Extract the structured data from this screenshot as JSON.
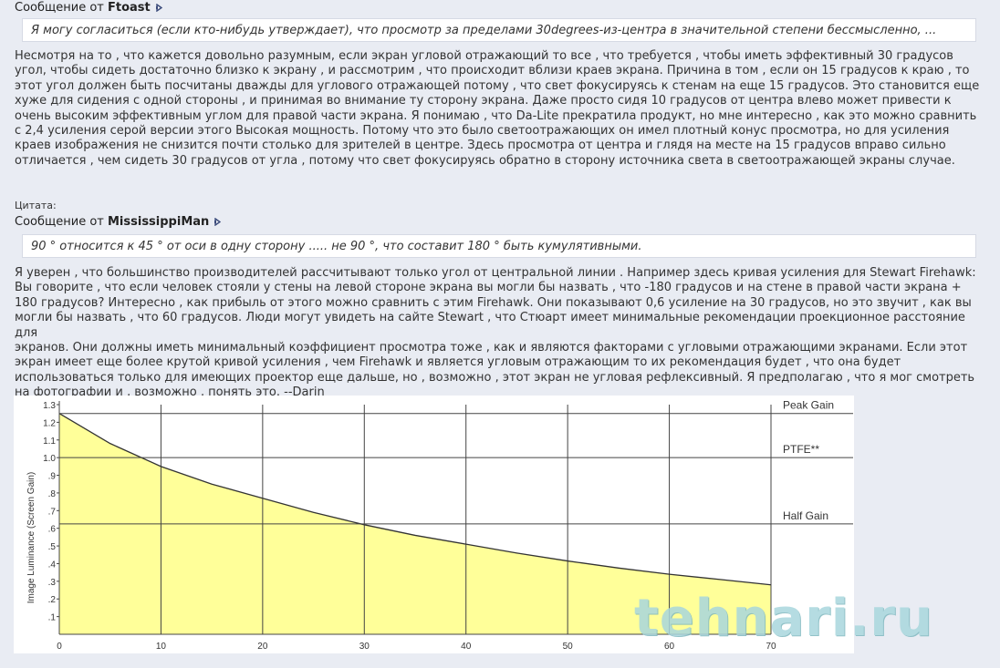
{
  "post1": {
    "quote_by_prefix": "Сообщение от",
    "quote_by_user": "Ftoast",
    "quote_text": "Я могу согласиться (если кто-нибудь утверждает), что просмотр за пределами 30degrees-из-центра в значительной степени бессмысленно, ...",
    "body": "Несмотря на то , что кажется довольно разумным, если экран угловой отражающий то все , что требуется , чтобы иметь эффективный 30 градусов\nугол, чтобы сидеть достаточно близко к экрану , и рассмотрим , что происходит вблизи краев экрана. Причина в том , если он 15 градусов к краю , то\nэтот угол должен быть посчитаны дважды для углового отражающей потому , что свет фокусируясь к стенам на еще 15 градусов. Это становится еще\nхуже для сидения с одной стороны , и принимая во внимание ту сторону экрана. Даже просто сидя 10 градусов от центра влево может привести к\nочень высоким эффективным углом для правой части экрана. Я понимаю , что Da-Lite прекратила продукт, но мне интересно , как это можно сравнить\nс 2,4 усиления серой версии этого Высокая мощность. Потому что это было светоотражающих он имел плотный конус просмотра, но для усиления\nкраев изображения не снизится почти столько для зрителей в центре. Здесь просмотра от центра и глядя на месте на 15 градусов вправо сильно\nотличается , чем сидеть 30 градусов от угла , потому что свет фокусируясь обратно в сторону источника света в светоотражающей экраны случае."
  },
  "post2": {
    "quote_label": "Цитата:",
    "quote_by_prefix": "Сообщение от",
    "quote_by_user": "MississippiMan",
    "quote_text": "90 ° относится к 45 ° от оси в одну сторону ..... не 90 °, что составит 180 ° быть кумулятивными.",
    "body": "Я уверен , что большинство производителей рассчитывают только угол от центральной линии . Например здесь кривая усиления для Stewart Firehawk:\nВы говорите , что если человек стояли у стены на левой стороне экрана вы могли бы назвать , что -180 градусов и на стене в правой части экрана +\n180 градусов? Интересно , как прибыль от этого можно сравнить с этим Firehawk. Они показывают 0,6 усиление на 30 градусов, но это звучит , как вы\nмогли бы назвать , что 60 градусов. Люди могут увидеть на сайте Stewart , что Стюарт имеет минимальные рекомендации проекционное расстояние для\nэкранов. Они должны иметь минимальный коэффициент просмотра тоже , как и являются факторами с угловыми отражающими экранами. Если этот\nэкран имеет еще более крутой кривой усиления , чем Firehawk и является угловым отражающим то их рекомендация будет , что она будет\nиспользоваться только для имеющих проектор еще дальше, но , возможно , этот экран не угловая рефлексивный. Я предполагаю , что я мог смотреть\nна фотографии и , возможно , понять это. --Darin"
  },
  "chart_data": {
    "type": "area",
    "ylabel": "Image Luminance (Screen Gain)",
    "x_ticks": [
      "0",
      "10",
      "20",
      "30",
      "40",
      "50",
      "60",
      "70"
    ],
    "y_ticks": [
      ".1",
      ".2",
      ".3",
      ".4",
      ".5",
      ".6",
      ".7",
      ".8",
      ".9",
      "1.0",
      "1.1",
      "1.2",
      "1.3"
    ],
    "xlim": [
      0,
      70
    ],
    "ylim": [
      0,
      1.3
    ],
    "x": [
      0,
      5,
      10,
      15,
      20,
      25,
      30,
      35,
      40,
      45,
      50,
      55,
      60,
      65,
      70
    ],
    "y": [
      1.25,
      1.08,
      0.95,
      0.85,
      0.77,
      0.69,
      0.62,
      0.56,
      0.51,
      0.46,
      0.415,
      0.375,
      0.34,
      0.31,
      0.28
    ],
    "reference_lines": [
      {
        "label": "Peak Gain",
        "y": 1.25
      },
      {
        "label": "PTFE**",
        "y": 1.0
      },
      {
        "label": "Half Gain",
        "y": 0.625
      }
    ],
    "fill_color": "#ffff99",
    "line_color": "#333333"
  },
  "watermark": "tehnari.ru"
}
